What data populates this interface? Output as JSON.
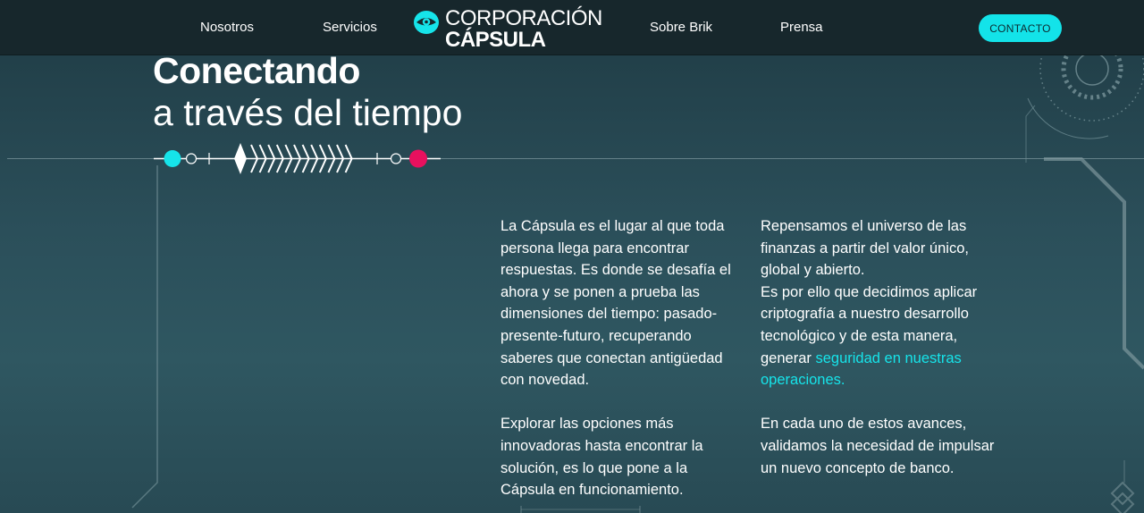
{
  "nav": {
    "items": [
      {
        "label": "Nosotros"
      },
      {
        "label": "Servicios"
      },
      {
        "label": "Sobre Brik"
      },
      {
        "label": "Prensa"
      }
    ],
    "logo": {
      "line1": "CORPORACIÓN",
      "line2": "CÁPSULA",
      "icon": "eye-icon"
    },
    "contact_label": "CONTACTO"
  },
  "hero": {
    "title": "Conectando",
    "subtitle": "a través del tiempo"
  },
  "columns": {
    "left": {
      "p1": "La Cápsula es el lugar al que toda persona llega para encontrar respuestas. Es donde se desafía el ahora y se ponen a prueba las dimensiones del tiempo: pasado-presente-futuro, recuperando saberes que conectan antigüedad con novedad.",
      "p2": "Explorar las opciones más innovadoras hasta encontrar la solución, es lo que pone a la Cápsula en funcionamiento."
    },
    "right": {
      "p1_line1": "Repensamos el universo de las finanzas a partir del valor único, global y abierto.",
      "p1_line2_start": "Es por ello que decidimos aplicar criptografía a nuestro desarrollo tecnológico y de esta manera, generar ",
      "p1_highlight": "seguridad en nuestras operaciones.",
      "p2": "En cada uno de estos avances, validamos la necesidad de impulsar un nuevo concepto de banco."
    }
  },
  "colors": {
    "accent": "#16e4ea",
    "pink": "#e8105e",
    "header_bg": "#17272c"
  }
}
